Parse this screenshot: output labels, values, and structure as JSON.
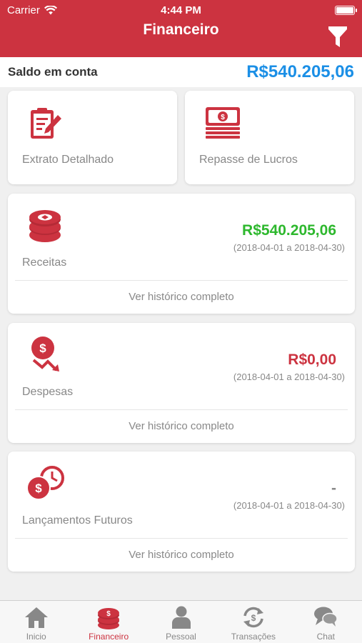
{
  "status_bar": {
    "carrier": "Carrier",
    "time": "4:44 PM"
  },
  "header": {
    "title": "Financeiro"
  },
  "balance": {
    "label": "Saldo em conta",
    "value": "R$540.205,06"
  },
  "quick_actions": [
    {
      "label": "Extrato Detalhado",
      "icon": "clipboard-edit-icon"
    },
    {
      "label": "Repasse de Lucros",
      "icon": "money-stack-icon"
    }
  ],
  "summaries": [
    {
      "label": "Receitas",
      "icon": "coins-icon",
      "amount": "R$540.205,06",
      "amount_color": "#2eb82e",
      "period": "(2018-04-01 a 2018-04-30)",
      "link": "Ver histórico completo"
    },
    {
      "label": "Despesas",
      "icon": "money-down-icon",
      "amount": "R$0,00",
      "amount_color": "#cc3340",
      "period": "(2018-04-01 a 2018-04-30)",
      "link": "Ver histórico completo"
    },
    {
      "label": "Lançamentos Futuros",
      "icon": "money-clock-icon",
      "amount": "-",
      "amount_color": "#888888",
      "period": "(2018-04-01 a 2018-04-30)",
      "link": "Ver histórico completo"
    }
  ],
  "tabs": [
    {
      "label": "Inicio",
      "icon": "home-icon",
      "active": false
    },
    {
      "label": "Financeiro",
      "icon": "coins-stack-icon",
      "active": true
    },
    {
      "label": "Pessoal",
      "icon": "person-icon",
      "active": false
    },
    {
      "label": "Transações",
      "icon": "exchange-icon",
      "active": false
    },
    {
      "label": "Chat",
      "icon": "chat-icon",
      "active": false
    }
  ],
  "colors": {
    "primary": "#cc3340",
    "balance": "#1b8fe6",
    "positive": "#2eb82e",
    "tab_inactive": "#888888"
  }
}
